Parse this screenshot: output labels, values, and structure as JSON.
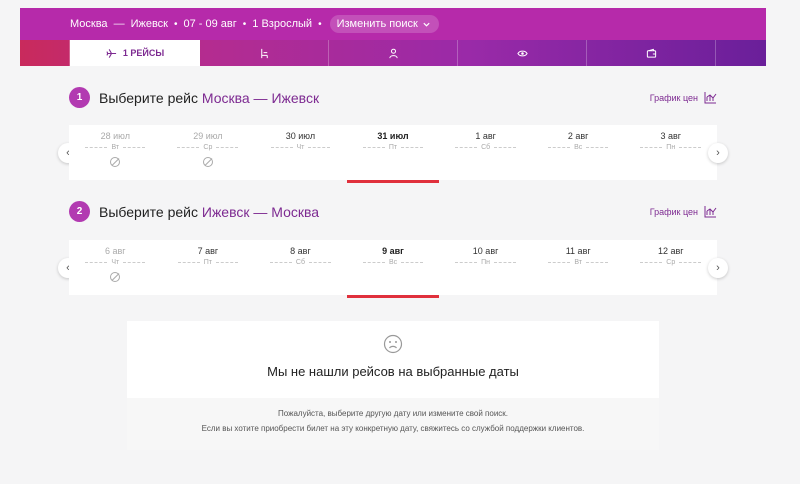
{
  "search": {
    "origin": "Москва",
    "dash": "—",
    "destination": "Ижевск",
    "dates": "07 - 09 авг",
    "passengers": "1 Взрослый",
    "change_label": "Изменить поиск"
  },
  "tabs": {
    "flights_label": "1  РЕЙСЫ",
    "icons": [
      "plane-icon",
      "seat-icon",
      "person-icon",
      "eye-icon",
      "wallet-icon"
    ]
  },
  "outbound": {
    "number": "1",
    "title_prefix": "Выберите рейс",
    "route": "Москва — Ижевск",
    "price_graph_label": "График цен",
    "dates": [
      {
        "date": "28 июл",
        "weekday": "Вт",
        "disabled": true
      },
      {
        "date": "29 июл",
        "weekday": "Ср",
        "disabled": true
      },
      {
        "date": "30 июл",
        "weekday": "Чт",
        "disabled": false
      },
      {
        "date": "31 июл",
        "weekday": "Пт",
        "disabled": false,
        "selected": true
      },
      {
        "date": "1 авг",
        "weekday": "Сб",
        "disabled": false
      },
      {
        "date": "2 авг",
        "weekday": "Вс",
        "disabled": false
      },
      {
        "date": "3 авг",
        "weekday": "Пн",
        "disabled": false
      }
    ]
  },
  "return": {
    "number": "2",
    "title_prefix": "Выберите рейс",
    "route": "Ижевск — Москва",
    "price_graph_label": "График цен",
    "dates": [
      {
        "date": "6 авг",
        "weekday": "Чт",
        "disabled": true
      },
      {
        "date": "7 авг",
        "weekday": "Пт",
        "disabled": false
      },
      {
        "date": "8 авг",
        "weekday": "Сб",
        "disabled": false
      },
      {
        "date": "9 авг",
        "weekday": "Вс",
        "disabled": false,
        "selected": true
      },
      {
        "date": "10 авг",
        "weekday": "Пн",
        "disabled": false
      },
      {
        "date": "11 авг",
        "weekday": "Вт",
        "disabled": false
      },
      {
        "date": "12 авг",
        "weekday": "Ср",
        "disabled": false
      }
    ]
  },
  "empty": {
    "title": "Мы не нашли рейсов на выбранные даты",
    "line1": "Пожалуйста, выберите другую дату или измените свой поиск.",
    "line2": "Если вы хотите приобрести билет на эту конкретную дату, свяжитесь со службой поддержки клиентов."
  },
  "colors": {
    "brand_purple": "#b62aaa",
    "route_purple": "#7d2a91",
    "selected_underline": "#e0303c"
  }
}
